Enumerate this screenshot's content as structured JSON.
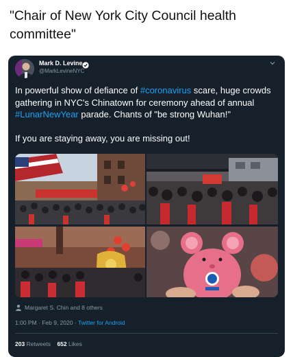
{
  "caption": "\"Chair of New York City Council health committee\"",
  "tweet": {
    "author_name": "Mark D. Levine",
    "author_handle": "@MarkLevineNYC",
    "text_part1": "In powerful show of defiance of ",
    "hashtag1": "#coronavirus",
    "text_part2": " scare, huge crowds gathering in NYC's Chinatown for ceremony ahead of annual ",
    "hashtag2": "#LunarNewYear",
    "text_part3": " parade. Chants of \"be strong Wuhan!\"",
    "text_line2": "If you are staying away, you are missing out!",
    "retweeted_by": "Margaret S. Chin and 8 others",
    "time": "1:00 PM · Feb 9, 2020 · ",
    "client": "Twitter for Android",
    "retweets_count": "203",
    "retweets_label": "Retweets",
    "likes_count": "652",
    "likes_label": "Likes"
  },
  "icons": {
    "verified": "verified-badge-icon",
    "chevron": "chevron-down-icon",
    "retweeted": "person-icon"
  },
  "colors": {
    "card_bg": "#15202b",
    "link": "#1da1f2",
    "muted": "#8899a6"
  }
}
